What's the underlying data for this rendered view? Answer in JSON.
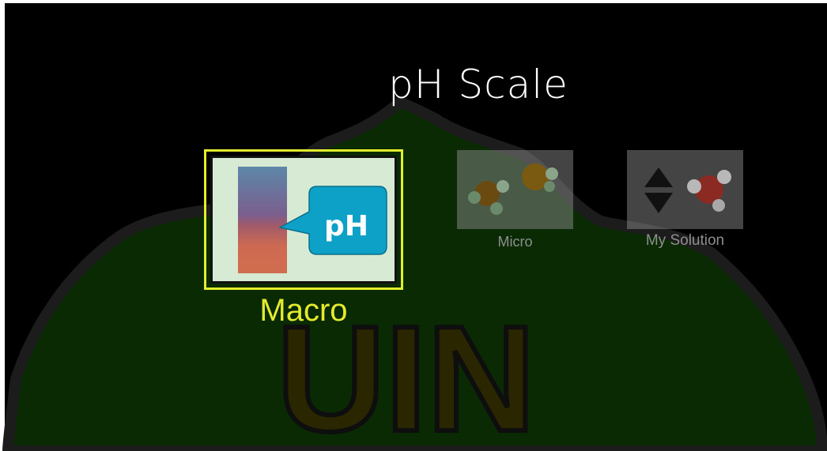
{
  "title": "pH Scale",
  "screens": [
    {
      "label": "Macro",
      "icon": "ph-meter-icon",
      "selected": true
    },
    {
      "label": "Micro",
      "icon": "molecules-icon",
      "selected": false
    },
    {
      "label": "My Solution",
      "icon": "up-down-molecule-icon",
      "selected": false
    }
  ],
  "watermark_text": "UIN",
  "colors": {
    "background": "#000000",
    "selected": "#e2ee2c",
    "unselected_label": "#8e8e8e",
    "ph_bubble": "#0aa0c8"
  }
}
